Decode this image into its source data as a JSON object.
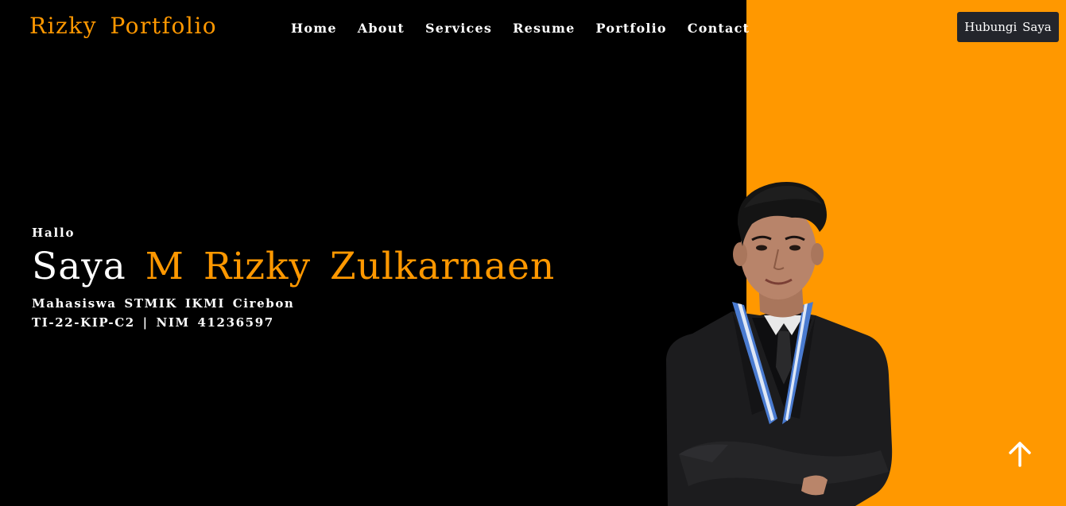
{
  "header": {
    "brand": "Rizky Portfolio",
    "nav": [
      {
        "label": "Home"
      },
      {
        "label": "About"
      },
      {
        "label": "Services"
      },
      {
        "label": "Resume"
      },
      {
        "label": "Portfolio"
      },
      {
        "label": "Contact"
      }
    ],
    "cta_label": "Hubungi Saya"
  },
  "hero": {
    "greeting": "Hallo",
    "title_prefix": "Saya",
    "title_name": "M Rizky Zulkarnaen",
    "subtitle_line1": "Mahasiswa STMIK IKMI Cirebon",
    "subtitle_line2": "TI-22-KIP-C2 | NIM 41236597"
  },
  "icons": {
    "scroll_top": "arrow-up-icon"
  },
  "colors": {
    "accent": "#ff9800",
    "background": "#000000",
    "button_bg": "#23252b"
  }
}
